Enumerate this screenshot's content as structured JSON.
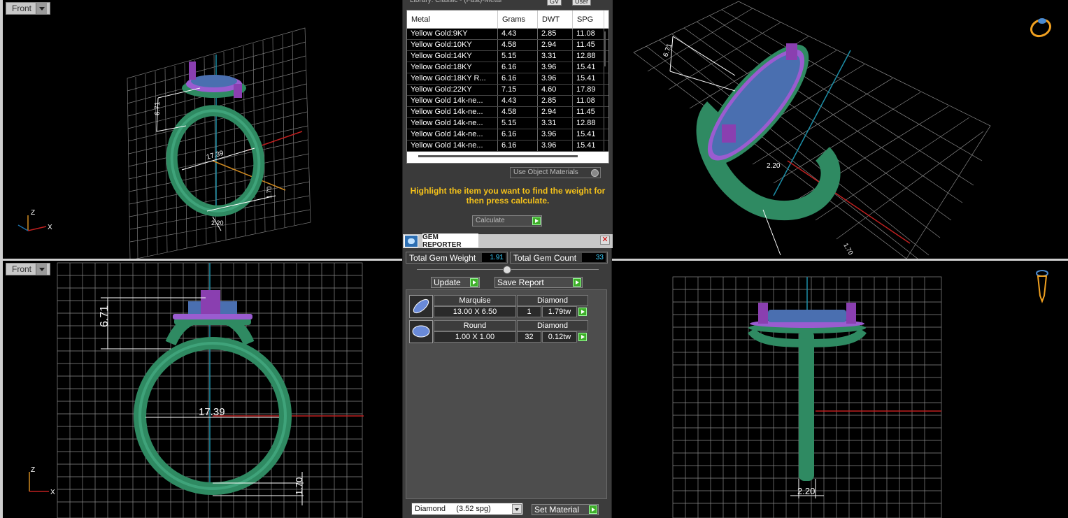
{
  "viewports": {
    "top_left": {
      "label": "Front",
      "dims": [
        "6.71",
        "17.39",
        "1.70",
        "2.20"
      ]
    },
    "top_right": {
      "dims": [
        "6.71",
        "2.20",
        "1.70"
      ]
    },
    "bottom_left": {
      "label": "Front",
      "dims": [
        "6.71",
        "17.39",
        "1.70"
      ]
    },
    "bottom_right": {
      "dims": [
        "2.20"
      ]
    }
  },
  "axes": {
    "z": "Z",
    "x": "X"
  },
  "metal_panel": {
    "library": "Library: Classic - (Fast)-Metal",
    "gv_label": "GV",
    "user_label": "User",
    "columns": [
      "Metal",
      "Grams",
      "DWT",
      "SPG"
    ],
    "rows": [
      [
        "Yellow Gold:9KY",
        "4.43",
        "2.85",
        "11.08"
      ],
      [
        "Yellow Gold:10KY",
        "4.58",
        "2.94",
        "11.45"
      ],
      [
        "Yellow Gold:14KY",
        "5.15",
        "3.31",
        "12.88"
      ],
      [
        "Yellow Gold:18KY",
        "6.16",
        "3.96",
        "15.41"
      ],
      [
        "Yellow Gold:18KY R...",
        "6.16",
        "3.96",
        "15.41"
      ],
      [
        "Yellow Gold:22KY",
        "7.15",
        "4.60",
        "17.89"
      ],
      [
        "Yellow Gold 14k-ne...",
        "4.43",
        "2.85",
        "11.08"
      ],
      [
        "Yellow Gold 14k-ne...",
        "4.58",
        "2.94",
        "11.45"
      ],
      [
        "Yellow Gold 14k-ne...",
        "5.15",
        "3.31",
        "12.88"
      ],
      [
        "Yellow Gold 14k-ne...",
        "6.16",
        "3.96",
        "15.41"
      ],
      [
        "Yellow Gold 14k-ne...",
        "6.16",
        "3.96",
        "15.41"
      ]
    ],
    "use_object_materials": "Use Object Materials",
    "hint": "Highlight the item you want to find the weight for then press calculate.",
    "calculate": "Calculate"
  },
  "gem_reporter": {
    "title": "GEM REPORTER",
    "total_weight_label": "Total Gem Weight",
    "total_weight": "1.91",
    "total_count_label": "Total Gem Count",
    "total_count": "33",
    "update": "Update",
    "save_report": "Save Report",
    "gems": [
      {
        "shape": "Marquise",
        "material": "Diamond",
        "size": "13.00 X 6.50",
        "qty": "1",
        "weight": "1.79tw"
      },
      {
        "shape": "Round",
        "material": "Diamond",
        "size": "1.00 X 1.00",
        "qty": "32",
        "weight": "0.12tw"
      }
    ],
    "material_select": "Diamond     (3.52 spg)",
    "set_material": "Set Material"
  },
  "colors": {
    "ring": "#2f8a62",
    "gem": "#4a6fb0",
    "prong": "#8a3fb0",
    "grid": "#8a8a8a",
    "accent_yellow": "#f5c21a"
  }
}
